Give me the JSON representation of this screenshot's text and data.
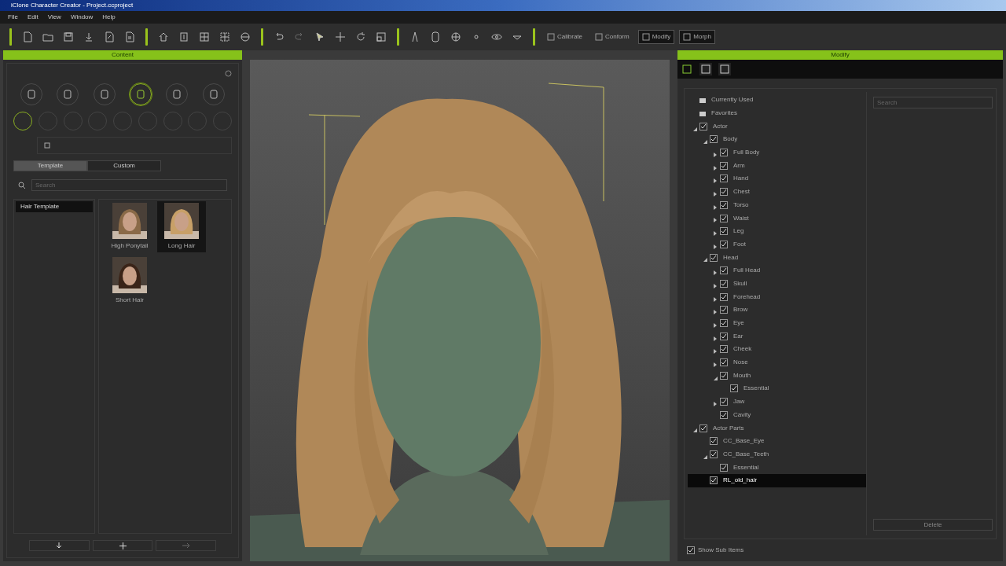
{
  "window": {
    "title": "iClone Character Creator - Project.ccproject"
  },
  "menu": [
    "File",
    "Edit",
    "View",
    "Window",
    "Help"
  ],
  "toolbar_buttons": [
    {
      "label": "Calibrate",
      "selected": false
    },
    {
      "label": "Conform",
      "selected": false
    },
    {
      "label": "Modify",
      "selected": true
    },
    {
      "label": "Morph",
      "selected": true
    }
  ],
  "content_panel": {
    "title": "Content",
    "categories": [
      {
        "selected": false
      },
      {
        "selected": false
      },
      {
        "selected": false
      },
      {
        "selected": true
      },
      {
        "selected": false
      },
      {
        "selected": false
      }
    ],
    "subcategories": [
      {
        "selected": true
      },
      {
        "selected": false
      },
      {
        "selected": false
      },
      {
        "selected": false
      },
      {
        "selected": false
      },
      {
        "selected": false
      },
      {
        "selected": false
      },
      {
        "selected": false
      },
      {
        "selected": false
      }
    ],
    "tabs": [
      {
        "label": "Template",
        "selected": true
      },
      {
        "label": "Custom",
        "selected": false
      }
    ],
    "search": {
      "placeholder": "Search"
    },
    "folders": [
      {
        "label": "Hair Template",
        "selected": true
      }
    ],
    "items": [
      {
        "label": "High Ponytail",
        "selected": false,
        "color": "#8a6a48"
      },
      {
        "label": "Long Hair",
        "selected": true,
        "color": "#c8a068"
      },
      {
        "label": "Short Hair",
        "selected": false,
        "color": "#3a2418"
      }
    ]
  },
  "modify_panel": {
    "title": "Modify",
    "tabs": [
      {
        "selected": true
      },
      {
        "selected": false
      },
      {
        "selected": false
      }
    ],
    "tree": [
      {
        "label": "Currently Used",
        "kind": "bullet",
        "selected": false
      },
      {
        "label": "Favorites",
        "kind": "bullet",
        "selected": false
      },
      {
        "label": "Actor",
        "kind": "check",
        "checked": true,
        "expanded": true,
        "selected": false,
        "children": [
          {
            "label": "Body",
            "kind": "check",
            "checked": true,
            "expanded": true,
            "selected": false,
            "children": [
              {
                "label": "Full Body",
                "kind": "check",
                "checked": true,
                "expanded": false,
                "selected": false
              },
              {
                "label": "Arm",
                "kind": "check",
                "checked": true,
                "expanded": false,
                "selected": false
              },
              {
                "label": "Hand",
                "kind": "check",
                "checked": true,
                "expanded": false,
                "selected": false
              },
              {
                "label": "Chest",
                "kind": "check",
                "checked": true,
                "expanded": false,
                "selected": false
              },
              {
                "label": "Torso",
                "kind": "check",
                "checked": true,
                "expanded": false,
                "selected": false
              },
              {
                "label": "Waist",
                "kind": "check",
                "checked": true,
                "expanded": false,
                "selected": false
              },
              {
                "label": "Leg",
                "kind": "check",
                "checked": true,
                "expanded": false,
                "selected": false
              },
              {
                "label": "Foot",
                "kind": "check",
                "checked": true,
                "expanded": false,
                "selected": false
              }
            ]
          },
          {
            "label": "Head",
            "kind": "check",
            "checked": true,
            "expanded": true,
            "selected": false,
            "children": [
              {
                "label": "Full Head",
                "kind": "check",
                "checked": true,
                "expanded": false,
                "selected": false
              },
              {
                "label": "Skull",
                "kind": "check",
                "checked": true,
                "expanded": false,
                "selected": false
              },
              {
                "label": "Forehead",
                "kind": "check",
                "checked": true,
                "expanded": false,
                "selected": false
              },
              {
                "label": "Brow",
                "kind": "check",
                "checked": true,
                "expanded": false,
                "selected": false
              },
              {
                "label": "Eye",
                "kind": "check",
                "checked": true,
                "expanded": false,
                "selected": false
              },
              {
                "label": "Ear",
                "kind": "check",
                "checked": true,
                "expanded": false,
                "selected": false
              },
              {
                "label": "Cheek",
                "kind": "check",
                "checked": true,
                "expanded": false,
                "selected": false
              },
              {
                "label": "Nose",
                "kind": "check",
                "checked": true,
                "expanded": false,
                "selected": false
              },
              {
                "label": "Mouth",
                "kind": "check",
                "checked": true,
                "expanded": true,
                "selected": false,
                "children": [
                  {
                    "label": "Essential",
                    "kind": "check",
                    "checked": true,
                    "selected": false
                  }
                ]
              },
              {
                "label": "Jaw",
                "kind": "check",
                "checked": true,
                "expanded": false,
                "selected": false
              },
              {
                "label": "Cavity",
                "kind": "check",
                "checked": true,
                "selected": false
              }
            ]
          }
        ]
      },
      {
        "label": "Actor Parts",
        "kind": "check",
        "checked": true,
        "expanded": true,
        "selected": false,
        "children": [
          {
            "label": "CC_Base_Eye",
            "kind": "check",
            "checked": true,
            "selected": false
          },
          {
            "label": "CC_Base_Teeth",
            "kind": "check",
            "checked": true,
            "expanded": true,
            "selected": false,
            "children": [
              {
                "label": "Essential",
                "kind": "check",
                "checked": true,
                "selected": false
              }
            ]
          },
          {
            "label": "RL_old_hair",
            "kind": "check",
            "checked": true,
            "selected": true
          }
        ]
      }
    ],
    "search": {
      "placeholder": "Search"
    },
    "button": {
      "label": "Delete",
      "disabled": true
    },
    "show_sub_items": {
      "label": "Show Sub Items",
      "checked": true
    }
  }
}
